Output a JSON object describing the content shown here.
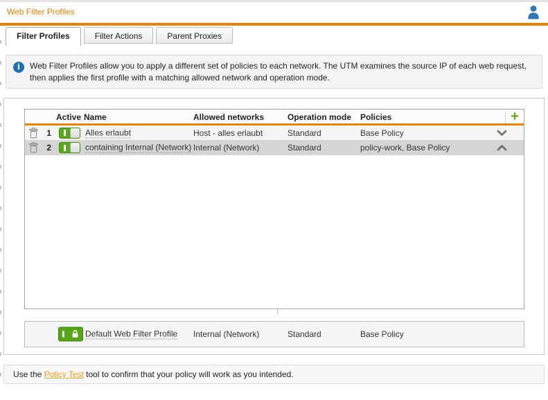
{
  "header": {
    "title": "Web Filter Profiles"
  },
  "icons": {
    "user": "user-icon",
    "info": "info-icon",
    "add": "plus-icon",
    "delete": "trash-icon",
    "expand": "chevron-down-icon",
    "collapse": "chevron-up-icon",
    "lock": "lock-icon",
    "toggle_on": "toggle-on"
  },
  "colors": {
    "accent_orange": "#ee7f01",
    "link_orange": "#f39c1f",
    "add_green": "#61a718",
    "toggle_green": "#5aa81c",
    "info_blue": "#1f6fb5",
    "user_blue": "#2e78b6",
    "selected_row_bg": "#d5d5d5"
  },
  "tabs": [
    {
      "label": "Filter Profiles",
      "active": true
    },
    {
      "label": "Filter Actions",
      "active": false
    },
    {
      "label": "Parent Proxies",
      "active": false
    }
  ],
  "info": {
    "line1": "Web Filter Profiles allow you to apply a different set of policies to each network. The UTM examines the source IP of each web request,",
    "line2": "then applies the first profile with a matching allowed network and operation mode."
  },
  "table": {
    "columns": [
      "Active",
      "Name",
      "Allowed networks",
      "Operation mode",
      "Policies"
    ],
    "add_button": "+",
    "rows": [
      {
        "index": "1",
        "active": true,
        "name": "Alles erlaubt",
        "networks": "Host - alles erlaubt",
        "mode": "Standard",
        "policies": "Base Policy",
        "chevron": "down",
        "selected": false
      },
      {
        "index": "2",
        "active": true,
        "name": "containing Internal (Network)",
        "networks": "Internal (Network)",
        "mode": "Standard",
        "policies": "policy-work, Base Policy",
        "chevron": "up",
        "selected": true
      }
    ]
  },
  "default_profile": {
    "name": "Default Web Filter Profile",
    "networks": "Internal (Network)",
    "mode": "Standard",
    "policies": "Base Policy",
    "active": true,
    "locked": true
  },
  "footer": {
    "prefix": "Use the ",
    "link_label": "Policy Test",
    "suffix": " tool to confirm that your policy will work as you intended."
  }
}
